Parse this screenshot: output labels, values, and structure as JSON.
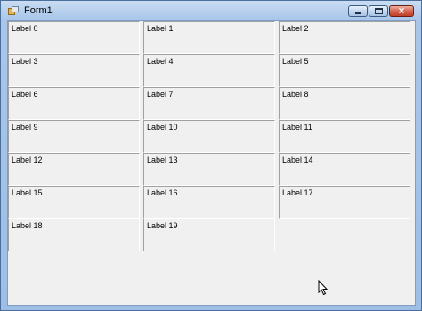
{
  "window": {
    "title": "Form1"
  },
  "labels": [
    "Label 0",
    "Label 1",
    "Label 2",
    "Label 3",
    "Label 4",
    "Label 5",
    "Label 6",
    "Label 7",
    "Label 8",
    "Label 9",
    "Label 10",
    "Label 11",
    "Label 12",
    "Label 13",
    "Label 14",
    "Label 15",
    "Label 16",
    "Label 17",
    "Label 18",
    "Label 19"
  ]
}
